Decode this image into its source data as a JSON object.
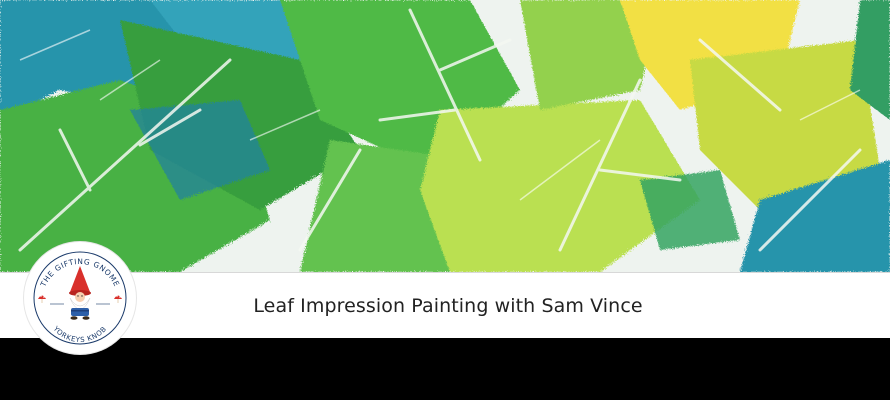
{
  "banner": {
    "title": "Leaf Impression Painting with Sam Vince"
  },
  "logo": {
    "top_text": "THE GIFTING GNOME",
    "bottom_text": "YORKEYS KNOB"
  },
  "colors": {
    "title_bar": "#ffffff",
    "bottom_bar": "#000000",
    "leaf_green": "#3fae3a",
    "leaf_lime": "#b8e04a",
    "leaf_yellow": "#f3e03a",
    "leaf_teal": "#1f8fa8"
  },
  "icons": [
    "leaf-painting-artwork",
    "gnome-icon",
    "mushroom-icon"
  ]
}
